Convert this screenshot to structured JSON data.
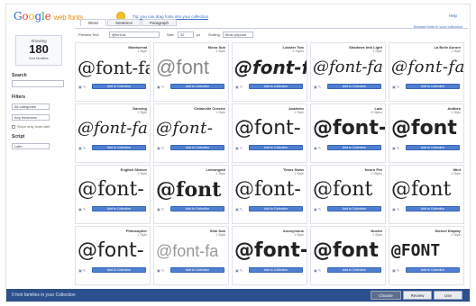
{
  "header": {
    "logo_google": [
      "G",
      "o",
      "o",
      "g",
      "l",
      "e"
    ],
    "logo_webfonts": "web fonts",
    "tip_text": "Tip: you can drag fonts into your collection",
    "help": "Help"
  },
  "sidebar": {
    "showing_label": "Showing",
    "count": "180",
    "count_sub": "font families",
    "search_label": "Search",
    "filters_label": "Filters",
    "filter_category": "All categories",
    "filter_thickness": "Any thickness",
    "filter_check": "Show only fonts with",
    "script_label": "Script",
    "script_value": "Latin"
  },
  "main": {
    "tabs": [
      "Word",
      "Sentence",
      "Paragraph"
    ],
    "preview_text_label": "Preview Text",
    "preview_text_value": "@font-fa",
    "size_label": "Size",
    "size_value": "32",
    "size_unit": "px",
    "sorting_label": "Sorting",
    "sorting_value": "Most popular",
    "collection_link": "Browse fonts in your collection"
  },
  "cards": [
    {
      "name": "Montserrat",
      "meta": "1 Style",
      "sample": "@font-fa",
      "style": "f-a"
    },
    {
      "name": "Mono Sub",
      "meta": "1 Style",
      "sample": "@font",
      "style": "f-b"
    },
    {
      "name": "Lobster Two",
      "meta": "4 Styles",
      "sample": "@font-fa",
      "style": "f-c"
    },
    {
      "name": "Shadows Into Light",
      "meta": "1 Style",
      "sample": "@font-fa",
      "style": "f-d"
    },
    {
      "name": "La Belle Aurore",
      "meta": "1 Style",
      "sample": "@font-fa",
      "style": "f-e"
    },
    {
      "name": "Dancing",
      "meta": "1 Style",
      "sample": "@font-fa",
      "style": "f-d"
    },
    {
      "name": "Cedarville Cursive",
      "meta": "1 Style",
      "sample": "@font-",
      "style": "f-e"
    },
    {
      "name": "Anaheim",
      "meta": "1 Style",
      "sample": "@font-",
      "style": "f-sans"
    },
    {
      "name": "Lato",
      "meta": "8 Styles",
      "sample": "@font-",
      "style": "f-sansb"
    },
    {
      "name": "Antibes",
      "meta": "1 Style",
      "sample": "@font",
      "style": "f-sansb"
    },
    {
      "name": "English Sharon",
      "meta": "1 Style",
      "sample": "@font-",
      "style": "f-serif"
    },
    {
      "name": "Lemongold",
      "meta": "1 Style",
      "sample": "@font",
      "style": "f-serifb"
    },
    {
      "name": "Times Swan",
      "meta": "1 Style",
      "sample": "@font-",
      "style": "f-serif"
    },
    {
      "name": "Neuro Pro",
      "meta": "2 Styles",
      "sample": "@font",
      "style": "f-serif"
    },
    {
      "name": "Mint",
      "meta": "1 Style",
      "sample": "@font",
      "style": "f-serif"
    },
    {
      "name": "Philosopher",
      "meta": "1 Style",
      "sample": "@font-",
      "style": "f-sans"
    },
    {
      "name": "Slim Sub",
      "meta": "1 Style",
      "sample": "@font-fa",
      "style": "f-thin"
    },
    {
      "name": "Anonymous",
      "meta": "1 Style",
      "sample": "@font-",
      "style": "f-sansb"
    },
    {
      "name": "Nunito",
      "meta": "1 Style",
      "sample": "@font",
      "style": "f-sansb"
    },
    {
      "name": "Stencil Display",
      "meta": "1 Style",
      "sample": "@FONT",
      "style": "f-mono"
    }
  ],
  "card_button": "Add to Collection",
  "bottom": {
    "collection_text": "0 font families in your Collection",
    "choose": "Choose",
    "review": "Review",
    "use": "Use"
  }
}
